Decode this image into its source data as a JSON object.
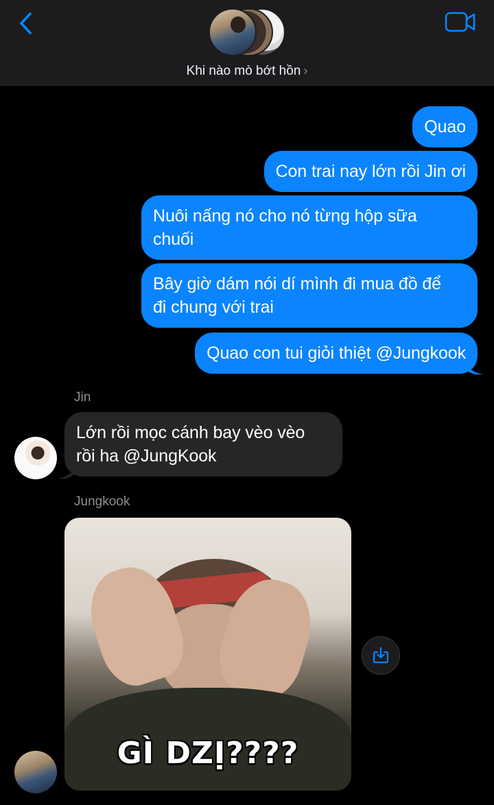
{
  "header": {
    "back_icon": "chevron-left-icon",
    "video_icon": "video-camera-icon",
    "group_name": "Khi nào mò bớt hồn",
    "chevron": "›"
  },
  "colors": {
    "accent": "#0a84ff",
    "outgoing_bubble": "#0a84ff",
    "incoming_bubble": "#262629",
    "header_bg": "#1c1c1e",
    "secondary_text": "#8e8e93"
  },
  "messages": {
    "out": [
      "Quao",
      "Con trai nay lớn rồi Jin ơi",
      "Nuôi nấng nó cho nó từng hộp sữa chuối",
      "Bây giờ dám nói dí mình đi mua đồ  để đi chung với trai",
      "Quao con tui giỏi thiệt @Jungkook"
    ],
    "out_lines": {
      "m3_l1": "Nuôi nấng nó cho nó từng hộp sữa",
      "m3_l2": "chuối",
      "m4_l1": "Bây giờ dám nói dí mình đi mua đồ  để",
      "m4_l2": "đi chung với trai"
    },
    "jin": {
      "sender": "Jin",
      "line1": "Lớn rồi mọc cánh bay vèo vèo",
      "line2": "rồi ha @JungKook"
    },
    "jungkook": {
      "sender": "Jungkook",
      "image_caption": "GÌ DZỊ????",
      "save_icon": "save-download-icon"
    }
  }
}
